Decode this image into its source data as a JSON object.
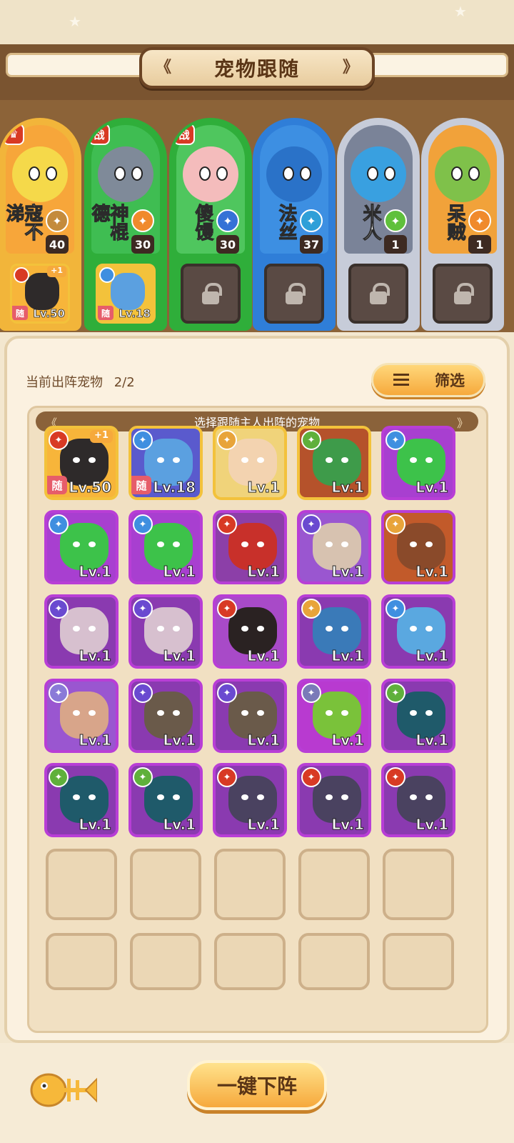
{
  "title": "宠物跟随",
  "heroes": [
    {
      "name": "寇不涕",
      "level": "40",
      "badge": "crown",
      "elem_color": "#c48b3c",
      "elem_icon": "crossed-swords-icon",
      "frame": "#f2b53a",
      "bg": "#f7a63a",
      "face": "#f5d94a",
      "follow": {
        "level": "Lv.50",
        "tag": "随",
        "plus": "+1"
      }
    },
    {
      "name": "神棍德",
      "level": "30",
      "badge": "战",
      "elem_color": "#f08a2c",
      "elem_icon": "paw-icon",
      "frame": "#2fae3a",
      "bg": "#3fbd52",
      "face": "#7f8a99",
      "follow": {
        "level": "Lv.18",
        "tag": "随",
        "plus": ""
      }
    },
    {
      "name": "傻馒",
      "level": "30",
      "badge": "战",
      "elem_color": "#3572d6",
      "elem_icon": "atom-icon",
      "frame": "#2fae3a",
      "bg": "#4fc65e",
      "face": "#f4bcbc",
      "follow": null
    },
    {
      "name": "法丝",
      "level": "37",
      "badge": "",
      "elem_color": "#2f9fd8",
      "elem_icon": "wind-icon",
      "frame": "#2f7ed8",
      "bg": "#3d8fe2",
      "face": "#2a72c8",
      "follow": null
    },
    {
      "name": "米人",
      "level": "1",
      "badge": "",
      "elem_color": "#5fc03b",
      "elem_icon": "leaf-icon",
      "frame": "#c7ccd9",
      "bg": "#7a8398",
      "face": "#39a0e0",
      "follow": null
    },
    {
      "name": "呆贼",
      "level": "1",
      "badge": "",
      "elem_color": "#f08a2c",
      "elem_icon": "crossed-tools-icon",
      "frame": "#c7ccd9",
      "bg": "#f1a23a",
      "face": "#7fc14a",
      "follow": null
    }
  ],
  "current": {
    "label": "当前出阵宠物",
    "count": "2/2"
  },
  "filter": {
    "label": "筛选"
  },
  "grid_header": "选择跟随主人出阵的宠物",
  "pets": [
    {
      "level": "Lv.50",
      "tag": "随",
      "plus": "+1",
      "elem": "#d83a24",
      "frame": "#f3c23b",
      "bg": "#f7b53a",
      "head": "#2e2a2a"
    },
    {
      "level": "Lv.18",
      "tag": "随",
      "plus": "",
      "elem": "#3f8fe0",
      "frame": "#f3c23b",
      "bg": "#5a5acd",
      "head": "#5ba0e0"
    },
    {
      "level": "Lv.1",
      "tag": "",
      "plus": "",
      "elem": "#e8a43a",
      "frame": "#f3c23b",
      "bg": "#f0d37a",
      "head": "#f3d3b0"
    },
    {
      "level": "Lv.1",
      "tag": "",
      "plus": "",
      "elem": "#5fb03b",
      "frame": "#f3c23b",
      "bg": "#b5522b",
      "head": "#3e9b4a"
    },
    {
      "level": "Lv.1",
      "tag": "",
      "plus": "",
      "elem": "#3f8fe0",
      "frame": "#b83ed6",
      "bg": "#a83fd0",
      "head": "#3dc24a"
    },
    {
      "level": "Lv.1",
      "tag": "",
      "plus": "",
      "elem": "#3f8fe0",
      "frame": "#b83ed6",
      "bg": "#a83fd0",
      "head": "#3dc24a"
    },
    {
      "level": "Lv.1",
      "tag": "",
      "plus": "",
      "elem": "#3f8fe0",
      "frame": "#b83ed6",
      "bg": "#a83fd0",
      "head": "#3dc24a"
    },
    {
      "level": "Lv.1",
      "tag": "",
      "plus": "",
      "elem": "#d83a24",
      "frame": "#b83ed6",
      "bg": "#8c3fa8",
      "head": "#c8302a"
    },
    {
      "level": "Lv.1",
      "tag": "",
      "plus": "",
      "elem": "#6a4ad0",
      "frame": "#b83ed6",
      "bg": "#9a56d0",
      "head": "#d7c2b0"
    },
    {
      "level": "Lv.1",
      "tag": "",
      "plus": "",
      "elem": "#e8a43a",
      "frame": "#b83ed6",
      "bg": "#c25a2a",
      "head": "#8a4a2a"
    },
    {
      "level": "Lv.1",
      "tag": "",
      "plus": "",
      "elem": "#6a4ad0",
      "frame": "#b83ed6",
      "bg": "#8a3ab0",
      "head": "#d7c0cf"
    },
    {
      "level": "Lv.1",
      "tag": "",
      "plus": "",
      "elem": "#6a4ad0",
      "frame": "#b83ed6",
      "bg": "#8a3ab0",
      "head": "#d7c0cf"
    },
    {
      "level": "Lv.1",
      "tag": "",
      "plus": "",
      "elem": "#d83a24",
      "frame": "#b83ed6",
      "bg": "#a84ac8",
      "head": "#2a2222"
    },
    {
      "level": "Lv.1",
      "tag": "",
      "plus": "",
      "elem": "#e8a43a",
      "frame": "#b83ed6",
      "bg": "#8a3ab0",
      "head": "#3a7ab8"
    },
    {
      "level": "Lv.1",
      "tag": "",
      "plus": "",
      "elem": "#3f8fe0",
      "frame": "#b83ed6",
      "bg": "#8a3ab0",
      "head": "#5aa8e0"
    },
    {
      "level": "Lv.1",
      "tag": "",
      "plus": "",
      "elem": "#8a7ad8",
      "frame": "#b83ed6",
      "bg": "#9a56d0",
      "head": "#d8a58a"
    },
    {
      "level": "Lv.1",
      "tag": "",
      "plus": "",
      "elem": "#6a4ad0",
      "frame": "#b83ed6",
      "bg": "#8a3ab0",
      "head": "#6a5a4a"
    },
    {
      "level": "Lv.1",
      "tag": "",
      "plus": "",
      "elem": "#6a4ad0",
      "frame": "#b83ed6",
      "bg": "#8a3ab0",
      "head": "#6a5a4a"
    },
    {
      "level": "Lv.1",
      "tag": "",
      "plus": "",
      "elem": "#7a7ab8",
      "frame": "#b83ed6",
      "bg": "#b83ad0",
      "head": "#7ac23a"
    },
    {
      "level": "Lv.1",
      "tag": "",
      "plus": "",
      "elem": "#5fb03b",
      "frame": "#b83ed6",
      "bg": "#8a3ab0",
      "head": "#1f5a6a"
    },
    {
      "level": "Lv.1",
      "tag": "",
      "plus": "",
      "elem": "#5fb03b",
      "frame": "#b83ed6",
      "bg": "#8a3ab0",
      "head": "#1f5a6a"
    },
    {
      "level": "Lv.1",
      "tag": "",
      "plus": "",
      "elem": "#5fb03b",
      "frame": "#b83ed6",
      "bg": "#8a3ab0",
      "head": "#1f5a6a"
    },
    {
      "level": "Lv.1",
      "tag": "",
      "plus": "",
      "elem": "#d83a24",
      "frame": "#b83ed6",
      "bg": "#8a3ab0",
      "head": "#4a4260"
    },
    {
      "level": "Lv.1",
      "tag": "",
      "plus": "",
      "elem": "#d83a24",
      "frame": "#b83ed6",
      "bg": "#8a3ab0",
      "head": "#4a4260"
    },
    {
      "level": "Lv.1",
      "tag": "",
      "plus": "",
      "elem": "#d83a24",
      "frame": "#b83ed6",
      "bg": "#8a3ab0",
      "head": "#4a4260"
    }
  ],
  "empty_slots": 10,
  "bottom": {
    "button_label": "一键下阵",
    "fish_icon": "fish-bone-icon"
  }
}
